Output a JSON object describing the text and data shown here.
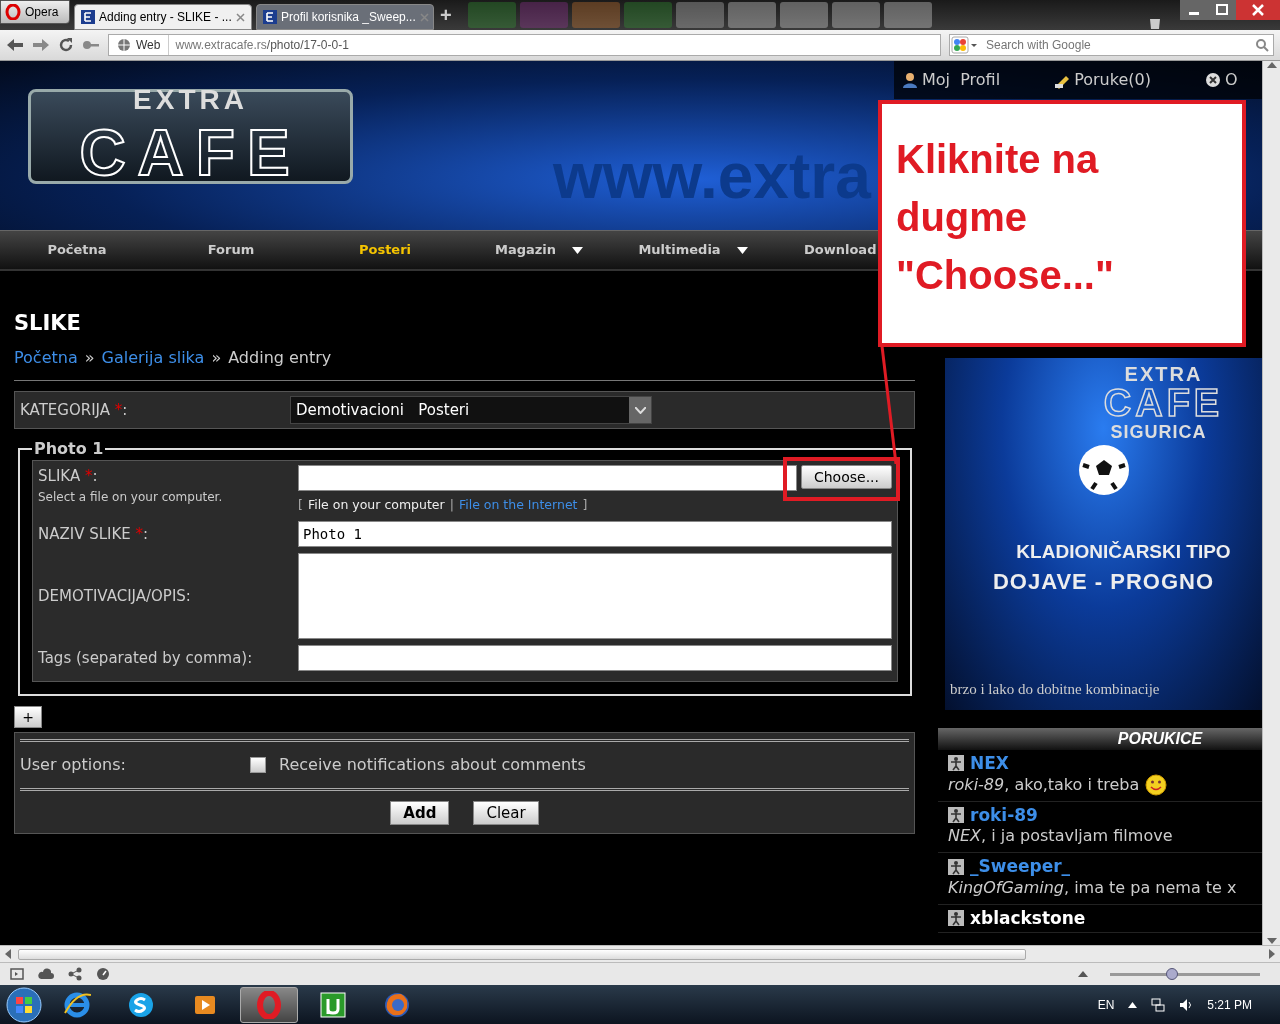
{
  "browser": {
    "menu_label": "Opera",
    "tabs": [
      {
        "label": "Adding entry - SLIKE - ...",
        "selected": true
      },
      {
        "label": "Profil korisnika _Sweep...",
        "selected": false
      }
    ],
    "new_tab": "+",
    "web_label": "Web",
    "address": {
      "host": "www.extracafe.rs",
      "path": "/photo/17-0-0-1"
    },
    "search": {
      "placeholder": "Search with Google"
    }
  },
  "site": {
    "logo": {
      "top": "EXTRA",
      "main": "CAFE"
    },
    "banner_text": "www.extra",
    "user_links": [
      {
        "label": "Moj  Profil",
        "kind": "profile"
      },
      {
        "label": "Poruke(0)",
        "kind": "messages"
      },
      {
        "label": "O",
        "kind": "logout"
      }
    ],
    "nav": [
      {
        "label": "Početna",
        "selected": false,
        "dropdown": false
      },
      {
        "label": "Forum",
        "selected": false,
        "dropdown": false
      },
      {
        "label": "Posteri",
        "selected": true,
        "dropdown": false
      },
      {
        "label": "Magazin",
        "selected": false,
        "dropdown": true
      },
      {
        "label": "Multimedia",
        "selected": false,
        "dropdown": true
      },
      {
        "label": "Download",
        "selected": false,
        "dropdown": false
      }
    ]
  },
  "page": {
    "title": "SLIKE",
    "breadcrumb": [
      {
        "label": "Početna",
        "kind": "link"
      },
      {
        "label": "»",
        "kind": "separator"
      },
      {
        "label": "Galerija slika",
        "kind": "link"
      },
      {
        "label": "»",
        "kind": "separator"
      },
      {
        "label": "Adding entry",
        "kind": "current"
      }
    ],
    "category": {
      "label": "KATEGORIJA",
      "required_mark": "*",
      "colon": ":",
      "value": "Demotivacioni   Posteri"
    },
    "photo": {
      "legend": "Photo 1",
      "fields": [
        {
          "kind": "file",
          "label": "SLIKA",
          "required_mark": "*",
          "colon": ":",
          "hint": "Select a file on your computer.",
          "button": "Choose...",
          "sources": {
            "open": "[",
            "separator": "|",
            "close": "]",
            "items": [
              {
                "label": "File on your computer",
                "selected": true
              },
              {
                "label": "File on the Internet",
                "selected": false
              }
            ]
          }
        },
        {
          "kind": "text",
          "label": "NAZIV SLIKE",
          "required_mark": "*",
          "colon": ":",
          "value": "Photo 1"
        },
        {
          "kind": "textarea",
          "label": "DEMOTIVACIJA/OPIS:"
        },
        {
          "kind": "text",
          "label": "Tags (separated by comma):"
        }
      ]
    },
    "add_button": "+",
    "user_options": {
      "label": "User options:",
      "option": "Receive notifications about comments",
      "checked": false
    },
    "buttons": [
      "Add",
      "Clear"
    ]
  },
  "callout": {
    "text": "Kliknite na dugme \"Choose...\""
  },
  "sidebar": {
    "ad": {
      "brand_top": "EXTRA",
      "brand": "CAFE",
      "sub": "SIGURICA",
      "line1": "KLADIONIČARSKI TIPO",
      "line2": "DOJAVE - PROGNO",
      "tagline": "brzo i lako do dobitne kombinacije"
    },
    "messages_title": "PORUKICE",
    "messages": [
      {
        "user": "NEX",
        "color": "#3d8ee8",
        "to": "roki-89",
        "text": ", ako,tako i treba",
        "smiley": true
      },
      {
        "user": "roki-89",
        "color": "#3d8ee8",
        "to": "NEX",
        "text": ", i ja postavljam filmove",
        "smiley": false
      },
      {
        "user": "_Sweeper_",
        "color": "#3d8ee8",
        "to": "KingOfGaming",
        "text": ", ima te pa nema te x",
        "smiley": false
      },
      {
        "user": "xblackstone",
        "color": "#ffffff"
      }
    ]
  },
  "taskbar": {
    "apps": [
      {
        "kind": "ie",
        "selected": false
      },
      {
        "kind": "skype",
        "selected": false
      },
      {
        "kind": "media",
        "selected": false
      },
      {
        "kind": "opera",
        "selected": true
      },
      {
        "kind": "torrent",
        "selected": false
      },
      {
        "kind": "firefox",
        "selected": false
      }
    ],
    "language": "EN",
    "time": "5:21 PM"
  },
  "status_bar": {
    "zoom": {
      "level": 0.42
    }
  }
}
